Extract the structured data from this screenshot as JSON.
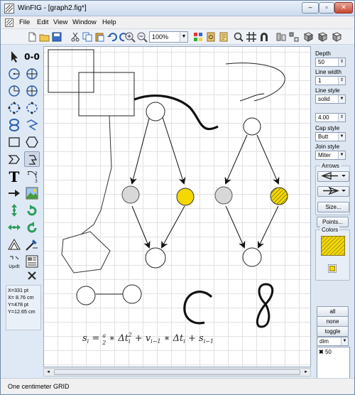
{
  "window": {
    "title": "WinFIG - [graph2.fig*]",
    "min_label": "–",
    "max_label": "▫",
    "close_label": "✕"
  },
  "menu": {
    "items": [
      "File",
      "Edit",
      "View",
      "Window",
      "Help"
    ]
  },
  "toolbar": {
    "zoom_value": "100%",
    "icons": [
      "new-file-icon",
      "open-folder-icon",
      "save-icon",
      "cut-icon",
      "copy-icon",
      "paste-icon",
      "undo-icon",
      "redo-icon",
      "zoom-in-icon",
      "zoom-out-icon",
      "grid-color-icon",
      "library-icon",
      "search-icon",
      "grid-icon",
      "magnet-icon",
      "align-icon",
      "rotate-cw-icon",
      "rotate-ccw-icon",
      "flip-icon"
    ]
  },
  "palette": {
    "tools": [
      "select-arrow-icon",
      "point-point-icon",
      "circle-radius-icon",
      "circle-diameter-icon",
      "ellipse-radius-icon",
      "ellipse-diameter-icon",
      "spline-closed-icon",
      "spline-open-icon",
      "curve-closed-icon",
      "curve-open-icon",
      "rectangle-icon",
      "polygon-icon",
      "interp-spline-closed-icon",
      "interp-spline-open-icon",
      "text-icon",
      "arc-icon",
      "arrow-line-icon",
      "picture-icon",
      "move-point-icon",
      "rotate-icon",
      "flip-horizontal-icon",
      "rotate-right-icon",
      "scale-icon",
      "edit-object-icon",
      "update-icon",
      "library-object-icon",
      "delete-icon"
    ],
    "update_label": "Updt"
  },
  "coords": {
    "x_pt": "X=331 pt",
    "x_cm": "X= 8.76 cm",
    "y_pt": "Y=478 pt",
    "y_cm": "Y=12.65 cm"
  },
  "status": {
    "text": "One centimeter GRID"
  },
  "right_panel": {
    "depth_label": "Depth",
    "depth_value": "50",
    "line_width_label": "Line width",
    "line_width_value": "1",
    "line_style_label": "Line style",
    "line_style_value": "solid",
    "dash_value": "4.00",
    "cap_style_label": "Cap style",
    "cap_style_value": "Butt",
    "join_style_label": "Join style",
    "join_style_value": "Miter",
    "arrows_label": "Arrows",
    "size_button": "Size...",
    "points_button": "Points...",
    "colors_label": "Colors",
    "all_button": "all",
    "none_button": "none",
    "toggle_button": "toggle",
    "dim_value": "dim",
    "layer_value": "50"
  },
  "canvas": {
    "formula": "s_i = a/2 * Δt_i^2 + v_{i-1} * Δt_i + s_{i-1}",
    "colors": {
      "yellow": "#f5d800",
      "gray": "#d8d8d8",
      "white": "#ffffff"
    }
  }
}
